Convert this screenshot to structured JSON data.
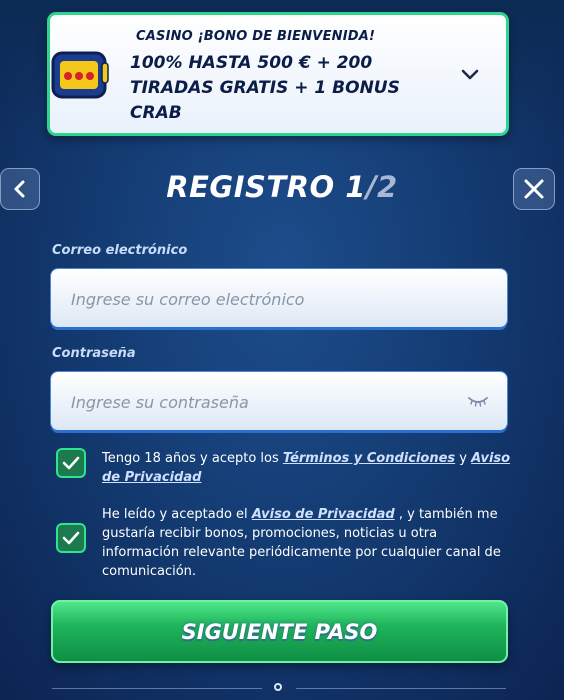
{
  "bonus": {
    "kicker": "CASINO ¡BONO DE BIENVENIDA!",
    "title": "100% HASTA 500 € + 200 TIRADAS GRATIS + 1 BONUS CRAB",
    "icon": "slot-machine-icon"
  },
  "header": {
    "title": "REGISTRO 1",
    "step": "/2",
    "back_icon": "chevron-left-icon",
    "close_icon": "close-icon"
  },
  "form": {
    "email": {
      "label": "Correo electrónico",
      "placeholder": "Ingrese su correo electrónico",
      "value": ""
    },
    "password": {
      "label": "Contraseña",
      "placeholder": "Ingrese su contraseña",
      "value": "",
      "icon": "eye-closed-icon"
    }
  },
  "consents": [
    {
      "checked": true,
      "pre": "Tengo 18 años y acepto los ",
      "link1": "Términos y Condiciones",
      "mid": " y ",
      "link2": "Aviso de Privacidad"
    },
    {
      "checked": true,
      "pre": "He leído y aceptado el ",
      "link1": "Aviso de Privacidad",
      "post": " , y también me gustaría recibir bonos, promociones, noticias u otra información relevante periódicamente por cualquier canal de comunicación."
    }
  ],
  "next_button": {
    "label": "SIGUIENTE PASO"
  },
  "colors": {
    "accent_green": "#2ee48f",
    "field_border": "#2b6fd0",
    "bg": "#143c73"
  }
}
